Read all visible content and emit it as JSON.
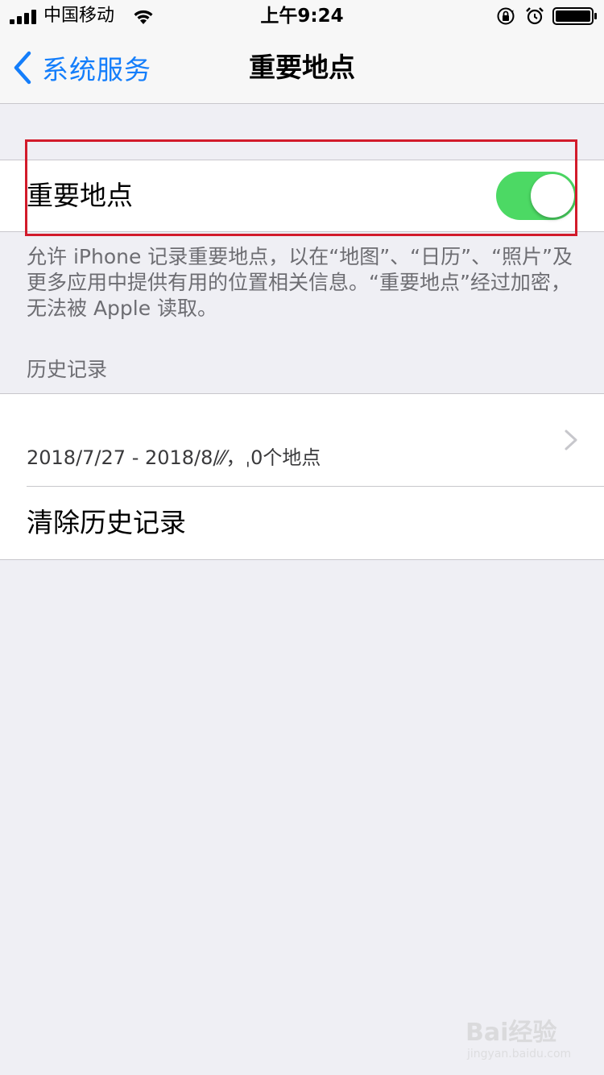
{
  "status_bar": {
    "carrier": "中国移动",
    "time": "上午9:24"
  },
  "nav": {
    "back_label": "系统服务",
    "title": "重要地点"
  },
  "toggle": {
    "label": "重要地点",
    "on": true,
    "color": "#4cd964"
  },
  "description": "允许 iPhone 记录重要地点，以在“地图”、“日历”、“照片”及更多应用中提供有用的位置相关信息。“重要地点”经过加密，无法被 Apple 读取。",
  "history": {
    "header": "历史记录",
    "entry_subtitle": "2018/7/27 - 2018/8/⁄⁄，ˌ0个地点",
    "clear_label": "清除历史记录"
  },
  "watermark": {
    "brand": "Bai经验",
    "url": "jingyan.baidu.com"
  },
  "colors": {
    "accent": "#147efb",
    "highlight_box": "#d21b2b"
  }
}
